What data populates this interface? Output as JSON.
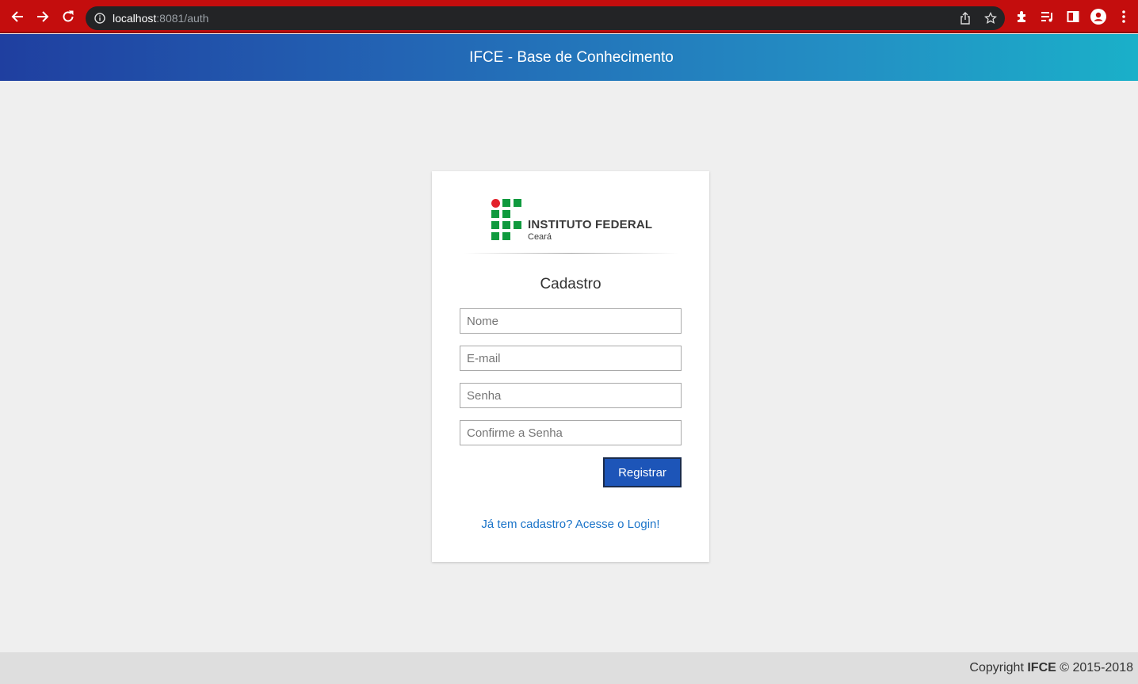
{
  "browser": {
    "url_host": "localhost",
    "url_rest": ":8081/auth"
  },
  "app": {
    "title": "IFCE - Base de Conhecimento"
  },
  "card": {
    "logo_text": "INSTITUTO FEDERAL",
    "logo_sub": "Ceará",
    "title": "Cadastro",
    "fields": {
      "name_placeholder": "Nome",
      "email_placeholder": "E-mail",
      "password_placeholder": "Senha",
      "confirm_placeholder": "Confirme a Senha"
    },
    "register_label": "Registrar",
    "login_link": "Já tem cadastro? Acesse o Login!"
  },
  "footer": {
    "prefix": "Copyright",
    "brand": "IFCE",
    "suffix": "© 2015-2018"
  },
  "colors": {
    "browser_bar": "#c40d0d",
    "header_start": "#1f3fa0",
    "header_end": "#1ab0c9",
    "button": "#1d55b8",
    "link": "#1a73c8",
    "logo_green": "#0f9a3e",
    "logo_red": "#e3212b"
  }
}
